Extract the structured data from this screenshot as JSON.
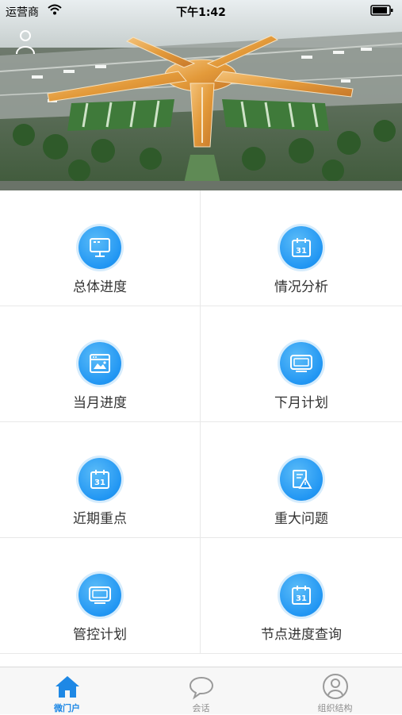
{
  "status_bar": {
    "carrier": "运营商",
    "time": "下午1:42"
  },
  "banner": {
    "image": "airport-aerial-photo",
    "user_icon": "user-icon"
  },
  "menu": [
    {
      "label": "总体进度",
      "icon": "monitor-icon"
    },
    {
      "label": "情况分析",
      "icon": "calendar-icon"
    },
    {
      "label": "当月进度",
      "icon": "browser-window-icon"
    },
    {
      "label": "下月计划",
      "icon": "display-icon"
    },
    {
      "label": "近期重点",
      "icon": "calendar-icon"
    },
    {
      "label": "重大问题",
      "icon": "report-warning-icon"
    },
    {
      "label": "管控计划",
      "icon": "display-icon"
    },
    {
      "label": "节点进度查询",
      "icon": "calendar-icon"
    }
  ],
  "tabs": [
    {
      "label": "微门户",
      "icon": "home-icon",
      "active": true
    },
    {
      "label": "会话",
      "icon": "chat-bubble-icon",
      "active": false
    },
    {
      "label": "组织结构",
      "icon": "person-icon",
      "active": false
    }
  ],
  "colors": {
    "accent": "#1e88e5",
    "icon_circle": "#2196f3",
    "label_text": "#333333",
    "tab_inactive": "#8e8e8e"
  }
}
